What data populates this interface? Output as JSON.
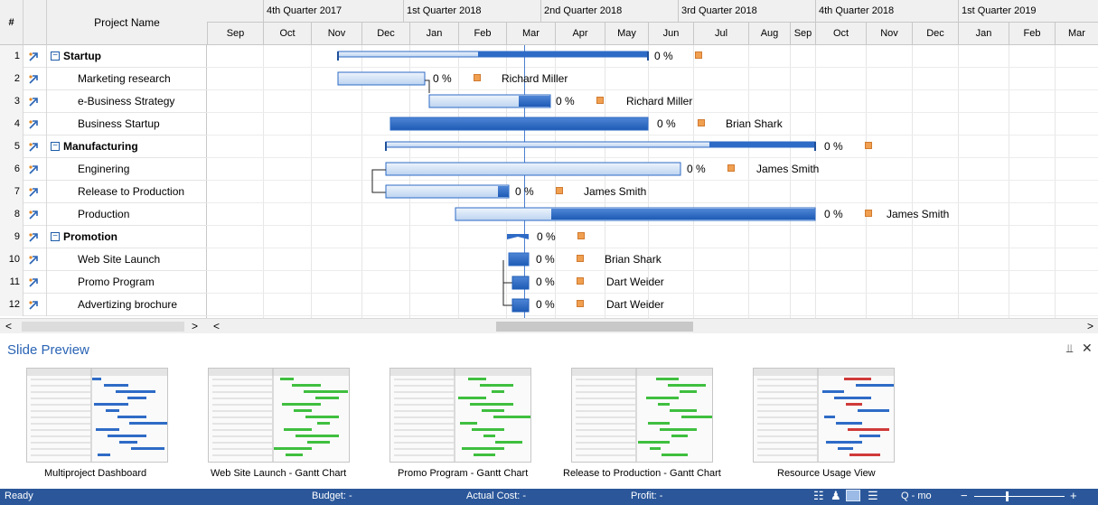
{
  "grid": {
    "header_num": "#",
    "header_name": "Project Name",
    "rows": [
      {
        "num": "1",
        "name": "Startup",
        "summary": true
      },
      {
        "num": "2",
        "name": "Marketing research",
        "summary": false
      },
      {
        "num": "3",
        "name": "e-Business Strategy",
        "summary": false
      },
      {
        "num": "4",
        "name": "Business Startup",
        "summary": false
      },
      {
        "num": "5",
        "name": "Manufacturing",
        "summary": true
      },
      {
        "num": "6",
        "name": "Enginering",
        "summary": false
      },
      {
        "num": "7",
        "name": "Release to Production",
        "summary": false
      },
      {
        "num": "8",
        "name": "Production",
        "summary": false
      },
      {
        "num": "9",
        "name": "Promotion",
        "summary": true
      },
      {
        "num": "10",
        "name": "Web Site Launch",
        "summary": false
      },
      {
        "num": "11",
        "name": "Promo Program",
        "summary": false
      },
      {
        "num": "12",
        "name": "Advertizing brochure",
        "summary": false
      }
    ]
  },
  "timeline": {
    "quarters": [
      "4th Quarter 2017",
      "1st Quarter 2018",
      "2nd Quarter 2018",
      "3rd Quarter 2018",
      "4th Quarter 2018",
      "1st Quarter 2019"
    ],
    "months": [
      "Sep",
      "Oct",
      "Nov",
      "Dec",
      "Jan",
      "Feb",
      "Mar",
      "Apr",
      "May",
      "Jun",
      "Jul",
      "Aug",
      "Sep",
      "Oct",
      "Nov",
      "Dec",
      "Jan",
      "Feb",
      "Mar"
    ]
  },
  "tasks": [
    {
      "percent": "0 %",
      "resource": ""
    },
    {
      "percent": "0 %",
      "resource": "Richard Miller"
    },
    {
      "percent": "0 %",
      "resource": "Richard Miller"
    },
    {
      "percent": "0 %",
      "resource": "Brian Shark"
    },
    {
      "percent": "0 %",
      "resource": ""
    },
    {
      "percent": "0 %",
      "resource": "James Smith"
    },
    {
      "percent": "0 %",
      "resource": "James Smith"
    },
    {
      "percent": "0 %",
      "resource": "James Smith"
    },
    {
      "percent": "0 %",
      "resource": ""
    },
    {
      "percent": "0 %",
      "resource": "Brian Shark"
    },
    {
      "percent": "0 %",
      "resource": "Dart Weider"
    },
    {
      "percent": "0 %",
      "resource": "Dart Weider"
    }
  ],
  "preview": {
    "title": "Slide Preview",
    "pin_icon": "pin-icon",
    "close_icon": "close-icon",
    "slides": [
      "Multiproject Dashboard",
      "Web Site Launch - Gantt Chart",
      "Promo Program - Gantt Chart",
      "Release to Production - Gantt Chart",
      "Resource Usage View"
    ]
  },
  "scroll": {
    "left_arrow": "<",
    "right_arrow": ">"
  },
  "status": {
    "ready": "Ready",
    "budget": "Budget: -",
    "actual_cost": "Actual Cost: -",
    "profit": "Profit: -",
    "zoom": "Q - mo"
  },
  "colors": {
    "accent": "#2b579a",
    "bar": "#2e6bc6",
    "bar_light": "#dce8f8",
    "resource": "#f0a050"
  }
}
